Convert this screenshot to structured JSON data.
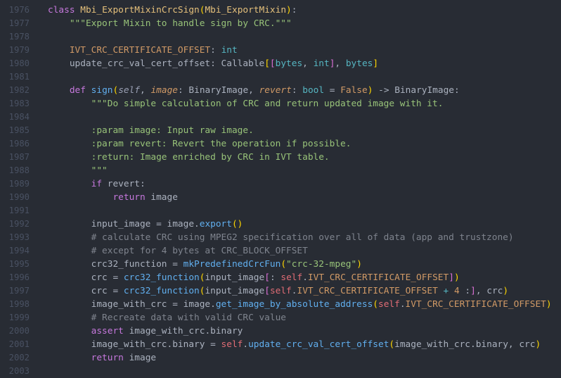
{
  "lines": [
    {
      "n": "1976",
      "tokens": [
        {
          "t": "class",
          "c": "kw"
        },
        {
          "t": " "
        },
        {
          "t": "Mbi_ExportMixinCrcSign",
          "c": "cls"
        },
        {
          "t": "(",
          "c": "b1"
        },
        {
          "t": "Mbi_ExportMixin",
          "c": "cls"
        },
        {
          "t": ")",
          "c": "b1"
        },
        {
          "t": ":"
        }
      ]
    },
    {
      "n": "1977",
      "tokens": [
        {
          "t": "    "
        },
        {
          "t": "\"\"\"Export Mixin to handle sign by CRC.\"\"\"",
          "c": "str"
        }
      ]
    },
    {
      "n": "1978",
      "tokens": []
    },
    {
      "n": "1979",
      "tokens": [
        {
          "t": "    "
        },
        {
          "t": "IVT_CRC_CERTIFICATE_OFFSET",
          "c": "attr"
        },
        {
          "t": ": "
        },
        {
          "t": "int",
          "c": "type"
        }
      ]
    },
    {
      "n": "1980",
      "tokens": [
        {
          "t": "    update_crc_val_cert_offset: Callable"
        },
        {
          "t": "[",
          "c": "b1"
        },
        {
          "t": "[",
          "c": "b2"
        },
        {
          "t": "bytes",
          "c": "type"
        },
        {
          "t": ", "
        },
        {
          "t": "int",
          "c": "type"
        },
        {
          "t": "]",
          "c": "b2"
        },
        {
          "t": ", "
        },
        {
          "t": "bytes",
          "c": "type"
        },
        {
          "t": "]",
          "c": "b1"
        }
      ]
    },
    {
      "n": "1981",
      "tokens": []
    },
    {
      "n": "1982",
      "tokens": [
        {
          "t": "    "
        },
        {
          "t": "def",
          "c": "kw"
        },
        {
          "t": " "
        },
        {
          "t": "sign",
          "c": "fn"
        },
        {
          "t": "(",
          "c": "b1"
        },
        {
          "t": "self",
          "c": "selfp"
        },
        {
          "t": ", "
        },
        {
          "t": "image",
          "c": "param"
        },
        {
          "t": ": BinaryImage, "
        },
        {
          "t": "revert",
          "c": "param"
        },
        {
          "t": ": "
        },
        {
          "t": "bool",
          "c": "type"
        },
        {
          "t": " = "
        },
        {
          "t": "False",
          "c": "num"
        },
        {
          "t": ")",
          "c": "b1"
        },
        {
          "t": " -> BinaryImage:"
        }
      ]
    },
    {
      "n": "1983",
      "tokens": [
        {
          "t": "        "
        },
        {
          "t": "\"\"\"Do simple calculation of CRC and return updated image with it.",
          "c": "str"
        }
      ]
    },
    {
      "n": "1984",
      "tokens": []
    },
    {
      "n": "1985",
      "tokens": [
        {
          "t": "        "
        },
        {
          "t": ":param image: Input raw image.",
          "c": "str"
        }
      ]
    },
    {
      "n": "1986",
      "tokens": [
        {
          "t": "        "
        },
        {
          "t": ":param revert: Revert the operation if possible.",
          "c": "str"
        }
      ]
    },
    {
      "n": "1987",
      "tokens": [
        {
          "t": "        "
        },
        {
          "t": ":return: Image enriched by CRC in IVT table.",
          "c": "str"
        }
      ]
    },
    {
      "n": "1988",
      "tokens": [
        {
          "t": "        "
        },
        {
          "t": "\"\"\"",
          "c": "str"
        }
      ]
    },
    {
      "n": "1989",
      "tokens": [
        {
          "t": "        "
        },
        {
          "t": "if",
          "c": "kw"
        },
        {
          "t": " revert:"
        }
      ]
    },
    {
      "n": "1990",
      "tokens": [
        {
          "t": "            "
        },
        {
          "t": "return",
          "c": "kw"
        },
        {
          "t": " image"
        }
      ]
    },
    {
      "n": "1991",
      "tokens": []
    },
    {
      "n": "1992",
      "tokens": [
        {
          "t": "        input_image = image."
        },
        {
          "t": "export",
          "c": "fn"
        },
        {
          "t": "()",
          "c": "b1"
        }
      ]
    },
    {
      "n": "1993",
      "tokens": [
        {
          "t": "        "
        },
        {
          "t": "# calculate CRC using MPEG2 specification over all of data (app and trustzone)",
          "c": "com"
        }
      ]
    },
    {
      "n": "1994",
      "tokens": [
        {
          "t": "        "
        },
        {
          "t": "# except for 4 bytes at CRC_BLOCK_OFFSET",
          "c": "com"
        }
      ]
    },
    {
      "n": "1995",
      "tokens": [
        {
          "t": "        crc32_function = "
        },
        {
          "t": "mkPredefinedCrcFun",
          "c": "fn"
        },
        {
          "t": "(",
          "c": "b1"
        },
        {
          "t": "\"crc-32-mpeg\"",
          "c": "str"
        },
        {
          "t": ")",
          "c": "b1"
        }
      ]
    },
    {
      "n": "1996",
      "tokens": [
        {
          "t": "        crc = "
        },
        {
          "t": "crc32_function",
          "c": "fn"
        },
        {
          "t": "(",
          "c": "b1"
        },
        {
          "t": "input_image"
        },
        {
          "t": "[",
          "c": "b2"
        },
        {
          "t": ": "
        },
        {
          "t": "self",
          "c": "self"
        },
        {
          "t": "."
        },
        {
          "t": "IVT_CRC_CERTIFICATE_OFFSET",
          "c": "attr"
        },
        {
          "t": "]",
          "c": "b2"
        },
        {
          "t": ")",
          "c": "b1"
        }
      ]
    },
    {
      "n": "1997",
      "tokens": [
        {
          "t": "        crc = "
        },
        {
          "t": "crc32_function",
          "c": "fn"
        },
        {
          "t": "(",
          "c": "b1"
        },
        {
          "t": "input_image"
        },
        {
          "t": "[",
          "c": "b2"
        },
        {
          "t": "self",
          "c": "self"
        },
        {
          "t": "."
        },
        {
          "t": "IVT_CRC_CERTIFICATE_OFFSET",
          "c": "attr"
        },
        {
          "t": " "
        },
        {
          "t": "+",
          "c": "op"
        },
        {
          "t": " "
        },
        {
          "t": "4",
          "c": "num"
        },
        {
          "t": " :"
        },
        {
          "t": "]",
          "c": "b2"
        },
        {
          "t": ", crc"
        },
        {
          "t": ")",
          "c": "b1"
        }
      ]
    },
    {
      "n": "1998",
      "tokens": [
        {
          "t": "        image_with_crc = image."
        },
        {
          "t": "get_image_by_absolute_address",
          "c": "fn"
        },
        {
          "t": "(",
          "c": "b1"
        },
        {
          "t": "self",
          "c": "self"
        },
        {
          "t": "."
        },
        {
          "t": "IVT_CRC_CERTIFICATE_OFFSET",
          "c": "attr"
        },
        {
          "t": ")",
          "c": "b1"
        }
      ]
    },
    {
      "n": "1999",
      "tokens": [
        {
          "t": "        "
        },
        {
          "t": "# Recreate data with valid CRC value",
          "c": "com"
        }
      ]
    },
    {
      "n": "2000",
      "tokens": [
        {
          "t": "        "
        },
        {
          "t": "assert",
          "c": "kw"
        },
        {
          "t": " image_with_crc.binary"
        }
      ]
    },
    {
      "n": "2001",
      "tokens": [
        {
          "t": "        image_with_crc.binary = "
        },
        {
          "t": "self",
          "c": "self"
        },
        {
          "t": "."
        },
        {
          "t": "update_crc_val_cert_offset",
          "c": "fn"
        },
        {
          "t": "(",
          "c": "b1"
        },
        {
          "t": "image_with_crc.binary, crc"
        },
        {
          "t": ")",
          "c": "b1"
        }
      ]
    },
    {
      "n": "2002",
      "tokens": [
        {
          "t": "        "
        },
        {
          "t": "return",
          "c": "kw"
        },
        {
          "t": " image"
        }
      ]
    },
    {
      "n": "2003",
      "tokens": []
    }
  ]
}
